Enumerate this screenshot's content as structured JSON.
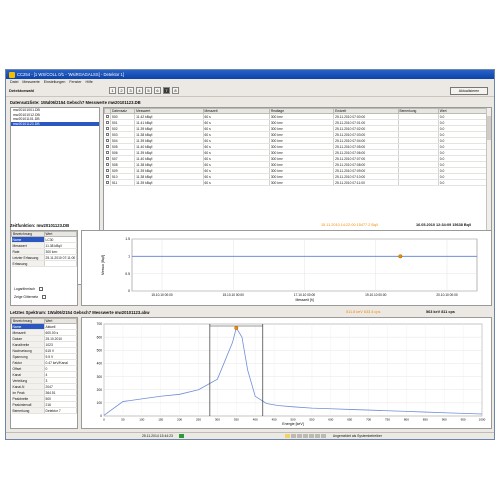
{
  "window": {
    "title": "CC254 - [1 WS/COLL 0/1 - 'WsiRGAGALSS] - Detektor 1]"
  },
  "menu": [
    "Datei",
    "Messwerte",
    "Einstellungen",
    "Fenster",
    "Hilfe"
  ],
  "toolbar": {
    "section_title": "Detektorwahl",
    "tabs": [
      "1",
      "2",
      "3",
      "4",
      "5",
      "6",
      "7",
      "8"
    ],
    "active_tab": "7",
    "update_label": "Aktualisieren"
  },
  "dataset": {
    "title": "Datensatzliste: 1Wal06/2154 Gebsch7 Messwerte mw20101123.DB",
    "list": [
      "mw20101001.DB",
      "mw20101012.DB",
      "mw20101101.DB",
      "mw20101123.DB"
    ],
    "selected_index": 3,
    "columns": [
      "Datensatz",
      "Messwert",
      "Messzeit",
      "Realtage",
      "Endzeit",
      "Bemerkung",
      "Wert"
    ],
    "rows": [
      [
        "500",
        "11.42 kBq/l",
        "60 s",
        "300 km³",
        "25.11.2010 07:00:00",
        "",
        "0.0"
      ],
      [
        "501",
        "11.41 kBq/l",
        "60 s",
        "300 km³",
        "25.11.2010 07:01:00",
        "",
        "0.0"
      ],
      [
        "502",
        "11.39 kBq/l",
        "60 s",
        "300 km³",
        "25.11.2010 07:02:00",
        "",
        "0.0"
      ],
      [
        "503",
        "11.38 kBq/l",
        "60 s",
        "300 km³",
        "25.11.2010 07:03:00",
        "",
        "0.0"
      ],
      [
        "504",
        "11.39 kBq/l",
        "60 s",
        "300 km³",
        "25.11.2010 07:04:00",
        "",
        "0.0"
      ],
      [
        "505",
        "11.40 kBq/l",
        "60 s",
        "300 km³",
        "25.11.2010 07:05:00",
        "",
        "0.0"
      ],
      [
        "506",
        "11.39 kBq/l",
        "60 s",
        "300 km³",
        "25.11.2010 07:06:00",
        "",
        "0.0"
      ],
      [
        "507",
        "11.40 kBq/l",
        "60 s",
        "300 km³",
        "25.11.2010 07:07:00",
        "",
        "0.0"
      ],
      [
        "508",
        "11.38 kBq/l",
        "60 s",
        "300 km³",
        "25.11.2010 07:08:00",
        "",
        "0.0"
      ],
      [
        "509",
        "11.39 kBq/l",
        "60 s",
        "300 km³",
        "25.11.2010 07:09:00",
        "",
        "0.0"
      ],
      [
        "510",
        "11.38 kBq/l",
        "60 s",
        "300 km³",
        "25.11.2010 07:10:00",
        "",
        "0.0"
      ],
      [
        "511",
        "11.39 kBq/l",
        "60 s",
        "300 km³",
        "25.11.2010 07:11:00",
        "",
        "0.0"
      ]
    ]
  },
  "timeseries": {
    "title": "Zeitfunktion: mw20101123.DB",
    "info_orange": "15.11.2010 14:22:00   15477.2 Bq/l",
    "info_right": "16.05.2010 12:34:09   15638 Bq/l",
    "prop_headers": [
      "Bezeichnung",
      "Wert"
    ],
    "props": [
      [
        "Name",
        "LC30"
      ],
      [
        "Messwert",
        "11.38 kBq/l"
      ],
      [
        "Rate",
        "300 km³"
      ],
      [
        "Letzter Erfassung",
        "25.11.2010 07:11:00"
      ],
      [
        "Erfassung",
        ""
      ]
    ],
    "props_selected": 0,
    "check_log": "Logarithmisch",
    "check_grid": "Zeige Gitternetz",
    "chart_data": {
      "type": "line",
      "ylabel": "Messw. [Bq/l]",
      "xlabel": "Messzeit [h]",
      "y_ticks": [
        "1.5",
        "1",
        "0.5",
        "0"
      ],
      "x_ticks": [
        "15.10.10 00:00",
        "15.10.10 00:00",
        "17.10.10 00:00",
        "19.10.10 00:00",
        "20.10.10 00:00"
      ],
      "series": [
        {
          "values": [
            1.0,
            1.0,
            1.0,
            1.0,
            1.0,
            1.0,
            1.0,
            1.0,
            1.0,
            1.0
          ]
        }
      ],
      "marker_index": 7,
      "ylim": [
        0,
        1.5
      ]
    }
  },
  "spectrum": {
    "title": "Letztes Spektrum: 1Wal06/2154 Gebsch7 Messwerte mw20101123.abw",
    "info_orange": "511.8 keV   633.4 cps",
    "info_right": "563 keV      811 cps",
    "prop_headers": [
      "Bezeichnung",
      "Wert"
    ],
    "props": [
      [
        "Name",
        "Aktuell"
      ],
      [
        "Messzeit",
        "600.00 s"
      ],
      [
        "Datum",
        "25.10.2010"
      ],
      [
        "Kanalbreite",
        "1023"
      ],
      [
        "Nachsetzung",
        "615 V"
      ],
      [
        "Spannung",
        "9.5 V"
      ],
      [
        "Faktor",
        "0.47 keV/Kanal"
      ],
      [
        "Offset",
        "0"
      ],
      [
        "Kanal",
        "4"
      ],
      [
        "Verteilung",
        "3"
      ],
      [
        "Kanal-N",
        "2047"
      ],
      [
        "Im Peak",
        "364.51"
      ],
      [
        "Peakbreite",
        "500"
      ],
      [
        "Peakintervall",
        "216"
      ],
      [
        "Bemerkung",
        "Detektor 7"
      ]
    ],
    "props_selected": 0,
    "chart_data": {
      "type": "line",
      "xlabel": "Energie [keV]",
      "ylabel": "",
      "ylim": [
        0,
        700
      ],
      "xlim": [
        0,
        1000
      ],
      "y_ticks": [
        "700",
        "600",
        "500",
        "400",
        "300",
        "200",
        "100",
        "0"
      ],
      "x_ticks": [
        "0",
        "50",
        "100",
        "150",
        "200",
        "250",
        "300",
        "350",
        "400",
        "450",
        "500",
        "550",
        "600",
        "650",
        "700",
        "750",
        "800",
        "850",
        "900",
        "950",
        "1000"
      ],
      "series": [
        {
          "x": [
            0,
            50,
            100,
            150,
            200,
            250,
            300,
            320,
            340,
            350,
            365,
            380,
            400,
            430,
            460,
            500,
            550,
            600,
            650,
            700,
            750,
            800,
            850,
            900,
            950,
            1000
          ],
          "y": [
            5,
            110,
            130,
            150,
            165,
            200,
            280,
            420,
            560,
            670,
            600,
            350,
            150,
            95,
            80,
            70,
            60,
            55,
            50,
            45,
            40,
            35,
            30,
            25,
            20,
            15
          ]
        }
      ],
      "cursors": [
        280,
        420
      ],
      "marker": [
        350,
        670
      ]
    }
  },
  "status": {
    "datetime": "25.11.2014 13:44:23",
    "text": "Angemeldet als Systembetreiber"
  }
}
